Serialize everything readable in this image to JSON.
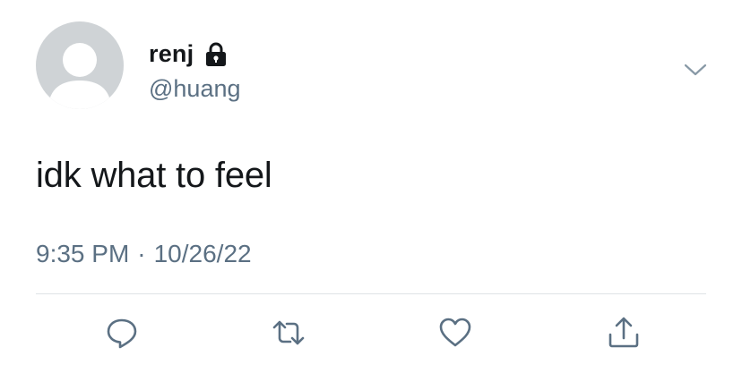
{
  "user": {
    "display_name": "renj",
    "handle": "@huang",
    "verified_icon": "lock-icon"
  },
  "tweet": {
    "text": "idk what to feel",
    "time": "9:35 PM",
    "separator": "·",
    "date": "10/26/22"
  },
  "actions": {
    "reply_icon": "reply-icon",
    "retweet_icon": "retweet-icon",
    "like_icon": "heart-icon",
    "share_icon": "share-icon"
  },
  "colors": {
    "text": "#14171a",
    "secondary": "#5b7083",
    "icon": "#5b7083",
    "avatar_bg": "#cfd3d6",
    "divider": "#dfe3e6"
  }
}
